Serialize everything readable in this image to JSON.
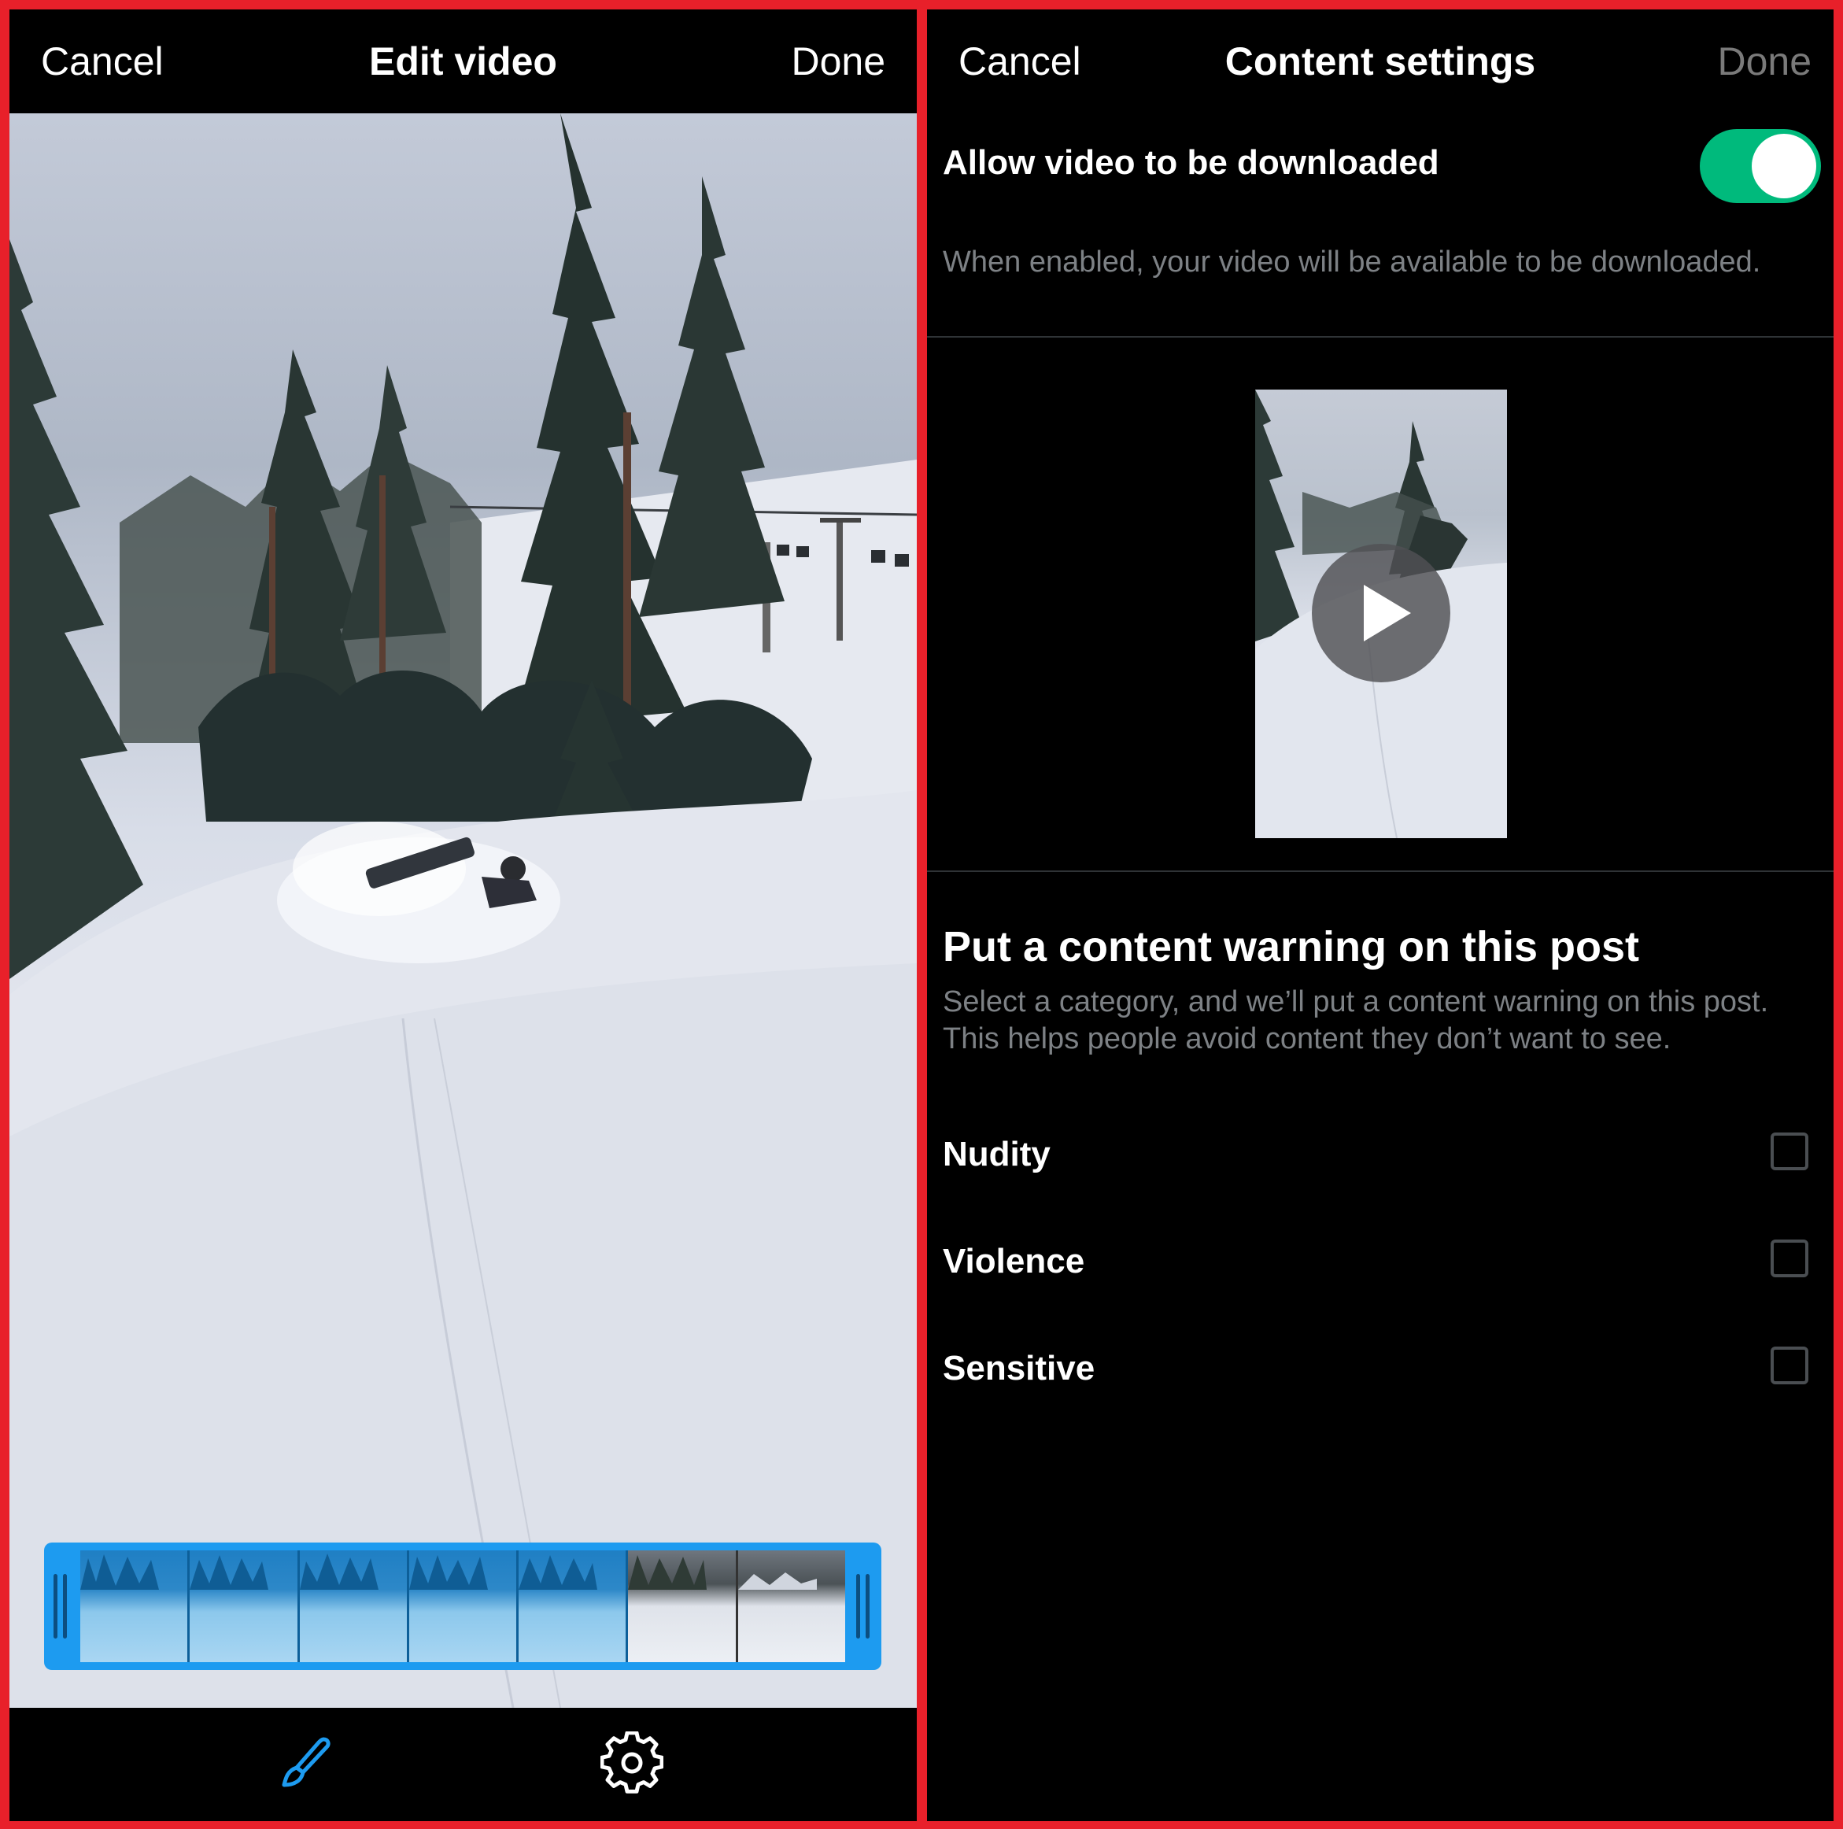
{
  "edit_video": {
    "cancel_label": "Cancel",
    "title": "Edit video",
    "done_label": "Done",
    "toolbar": {
      "brush_icon": "brush-icon",
      "settings_icon": "gear-icon",
      "active_color": "#1d9bf0"
    },
    "trim": {
      "accent_color": "#1d9bf0",
      "frame_count": 7
    }
  },
  "content_settings": {
    "cancel_label": "Cancel",
    "title": "Content settings",
    "done_label": "Done",
    "download": {
      "label": "Allow video to be downloaded",
      "enabled": true,
      "toggle_color": "#00ba7c",
      "description": "When enabled, your video will be available to be downloaded."
    },
    "warning": {
      "title": "Put a content warning on this post",
      "description": "Select a category, and we’ll put a content warning on this post. This helps people avoid content they don’t want to see.",
      "options": [
        {
          "label": "Nudity",
          "checked": false
        },
        {
          "label": "Violence",
          "checked": false
        },
        {
          "label": "Sensitive",
          "checked": false
        }
      ]
    }
  }
}
